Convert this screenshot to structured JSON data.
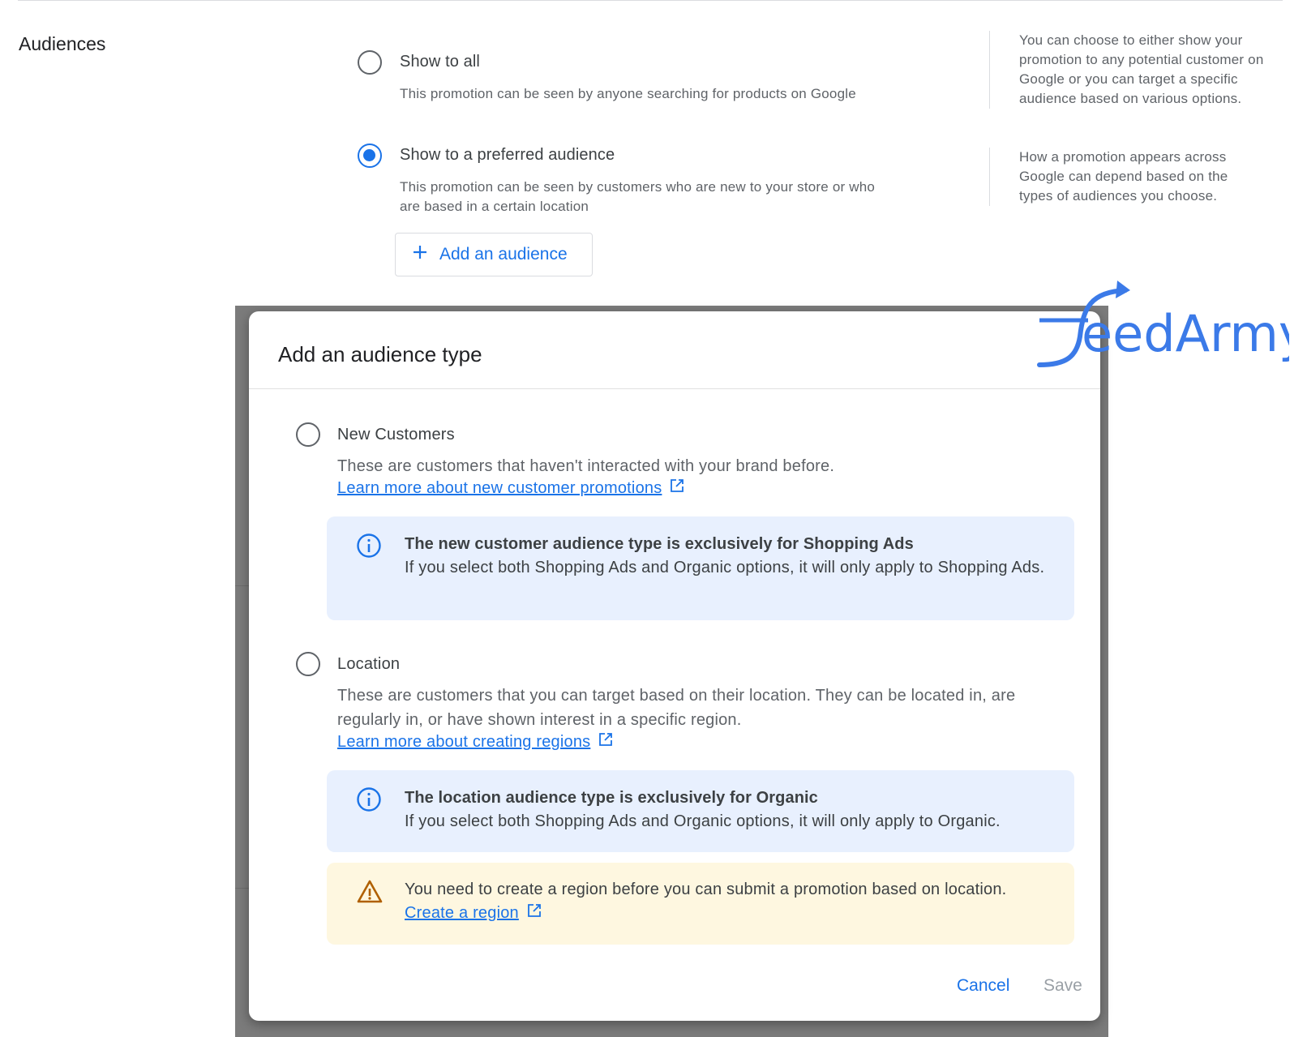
{
  "section": {
    "title": "Audiences"
  },
  "options": {
    "show_all": {
      "label": "Show to all",
      "desc": "This promotion can be seen by anyone searching for products on Google"
    },
    "preferred": {
      "label": "Show to a preferred audience",
      "desc_line1": "This promotion can be seen by customers who are new to your store or who",
      "desc_line2": "are based in a certain location"
    }
  },
  "help": {
    "first": "You can choose to either show your promotion to any potential customer on Google or you can target a specific audience based on various options.",
    "second": "How a promotion appears across Google can depend based on the types of audiences you choose."
  },
  "add_audience_button": {
    "label": "Add an audience"
  },
  "dialog": {
    "title": "Add an audience type",
    "new_customers": {
      "label": "New Customers",
      "desc": "These are customers that haven't interacted with your brand before.",
      "link": "Learn more about new customer promotions",
      "info_title": "The new customer audience type is exclusively for Shopping Ads",
      "info_text": "If you select both Shopping Ads and Organic options, it will only apply to Shopping Ads."
    },
    "location": {
      "label": "Location",
      "desc": "These are customers that you can target based on their location. They can be located in, are regularly in, or have shown interest in a specific region.",
      "link": "Learn more about creating regions",
      "info_title": "The location audience type is exclusively for Organic",
      "info_text": "If you select both Shopping Ads and Organic options, it will only apply to Organic.",
      "warning_text": "You need to create a region before you can submit a promotion based on location.",
      "warning_link": "Create a region"
    },
    "cancel_label": "Cancel",
    "save_label": "Save"
  },
  "logo": {
    "text": "FeedArmy"
  },
  "colors": {
    "accent": "#1a73e8",
    "info_bg": "#e8f0fe",
    "warn_bg": "#fef7e0",
    "warn_icon": "#b06000"
  }
}
